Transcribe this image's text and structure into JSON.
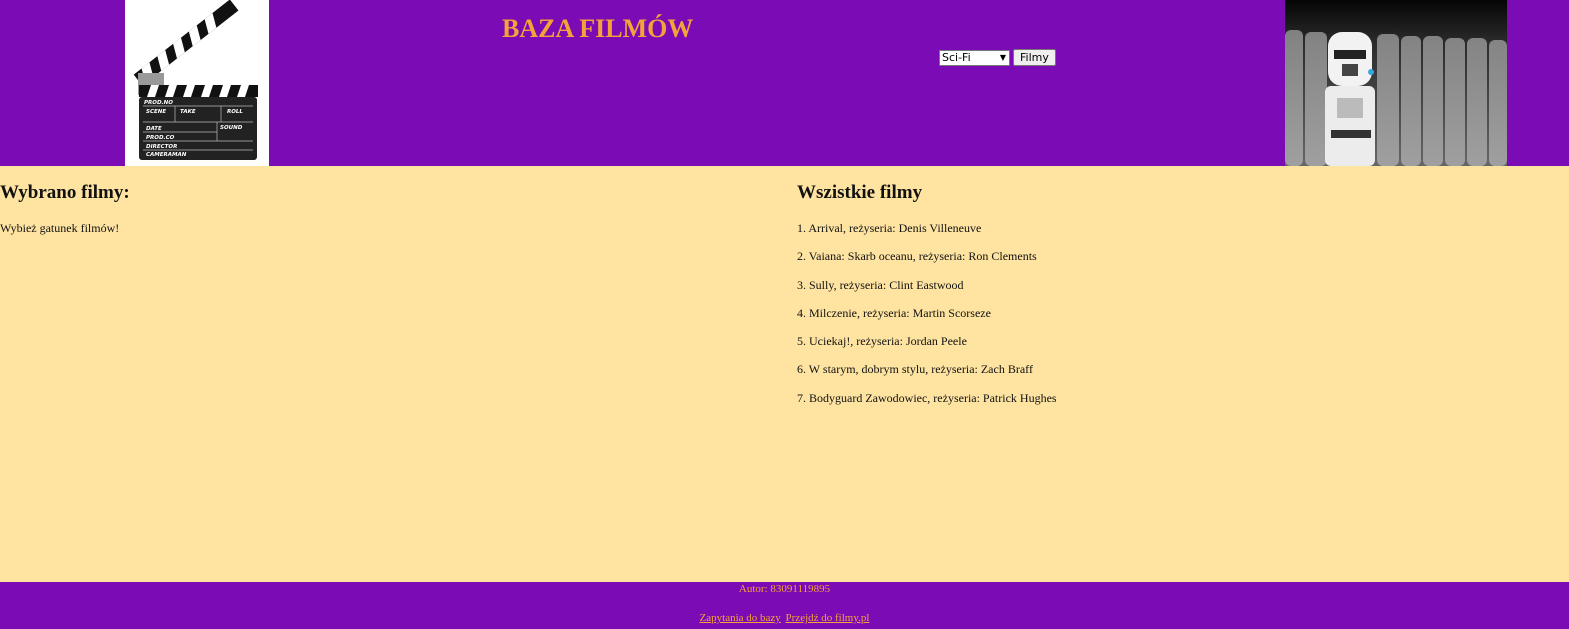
{
  "header": {
    "title": "BAZA FILMÓW",
    "genre_select": {
      "selected": "Sci-Fi"
    },
    "films_button": "Filmy",
    "clapperboard": [
      "PROD.NO",
      "SCENE",
      "TAKE",
      "ROLL",
      "DATE",
      "SOUND",
      "PROD.CO",
      "DIRECTOR",
      "CAMERAMAN"
    ]
  },
  "left": {
    "heading": "Wybrano filmy:",
    "hint": "Wybież gatunek filmów!"
  },
  "right": {
    "heading": "Wszistkie filmy",
    "films": [
      "1. Arrival, reżyseria: Denis Villeneuve",
      "2. Vaiana: Skarb oceanu, reżyseria: Ron Clements",
      "3. Sully, reżyseria: Clint Eastwood",
      "4. Milczenie, reżyseria: Martin Scorseze",
      "5. Uciekaj!, reżyseria: Jordan Peele",
      "6. W starym, dobrym stylu, reżyseria: Zach Braff",
      "7. Bodyguard Zawodowiec, reżyseria: Patrick Hughes"
    ]
  },
  "footer": {
    "author": "Autor: 83091119895",
    "link_queries": "Zapytania do bazy",
    "link_films": "Przejdź do filmy.pl"
  },
  "colors": {
    "header_bg": "#7a0bb5",
    "title": "#f4a23a",
    "content_bg": "#ffe4a1"
  }
}
